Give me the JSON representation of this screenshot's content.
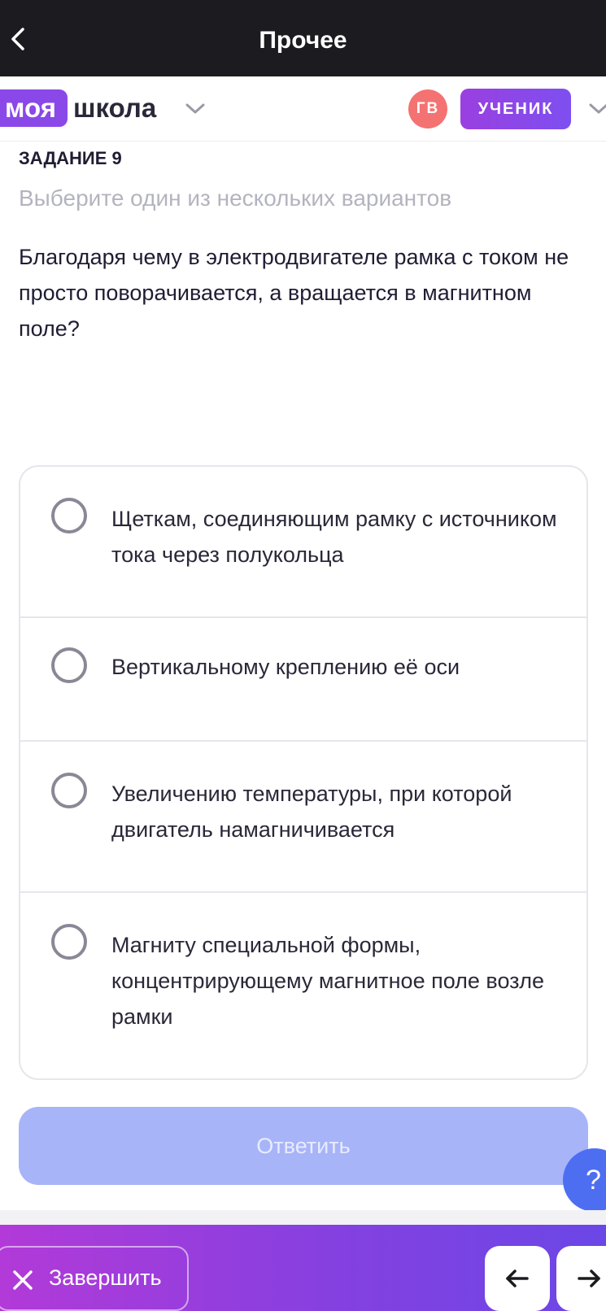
{
  "header": {
    "title": "Прочее"
  },
  "school": {
    "logo_part1": "моя",
    "logo_part2": "школа"
  },
  "user": {
    "initials": "ГВ",
    "role": "УЧЕНИК"
  },
  "task": {
    "label": "ЗАДАНИЕ 9",
    "hint": "Выберите один из нескольких вариантов",
    "question": "Благодаря чему в электродвигателе рамка с током не просто поворачивается, а вращается в магнитном поле?",
    "options": [
      {
        "text": "Щеткам, соединяющим рамку с источником тока через полукольца"
      },
      {
        "text": "Вертикальному креплению её оси"
      },
      {
        "text": "Увеличению температуры, при которой двигатель намагничивается"
      },
      {
        "text": "Магниту специальной формы, концентрирующему магнитное поле возле рамки"
      }
    ],
    "answer_label": "Ответить"
  },
  "help": {
    "label": "?"
  },
  "footer": {
    "finish_label": "Завершить"
  },
  "icons": {
    "back": "chevron-left-icon",
    "dropdown": "chevron-down-icon",
    "finish": "close-icon",
    "prev": "arrow-left-icon",
    "next": "arrow-right-icon"
  },
  "colors": {
    "topbar": "#1c1b1f",
    "logo": "#8b48e8",
    "avatar": "#f47272",
    "role_badge": "#8a45ea",
    "answer_button_disabled": "#a8b4f8",
    "help_button": "#4e6ef2",
    "bottom_bar_start": "#b23ad8",
    "bottom_bar_end": "#6b47e6"
  }
}
